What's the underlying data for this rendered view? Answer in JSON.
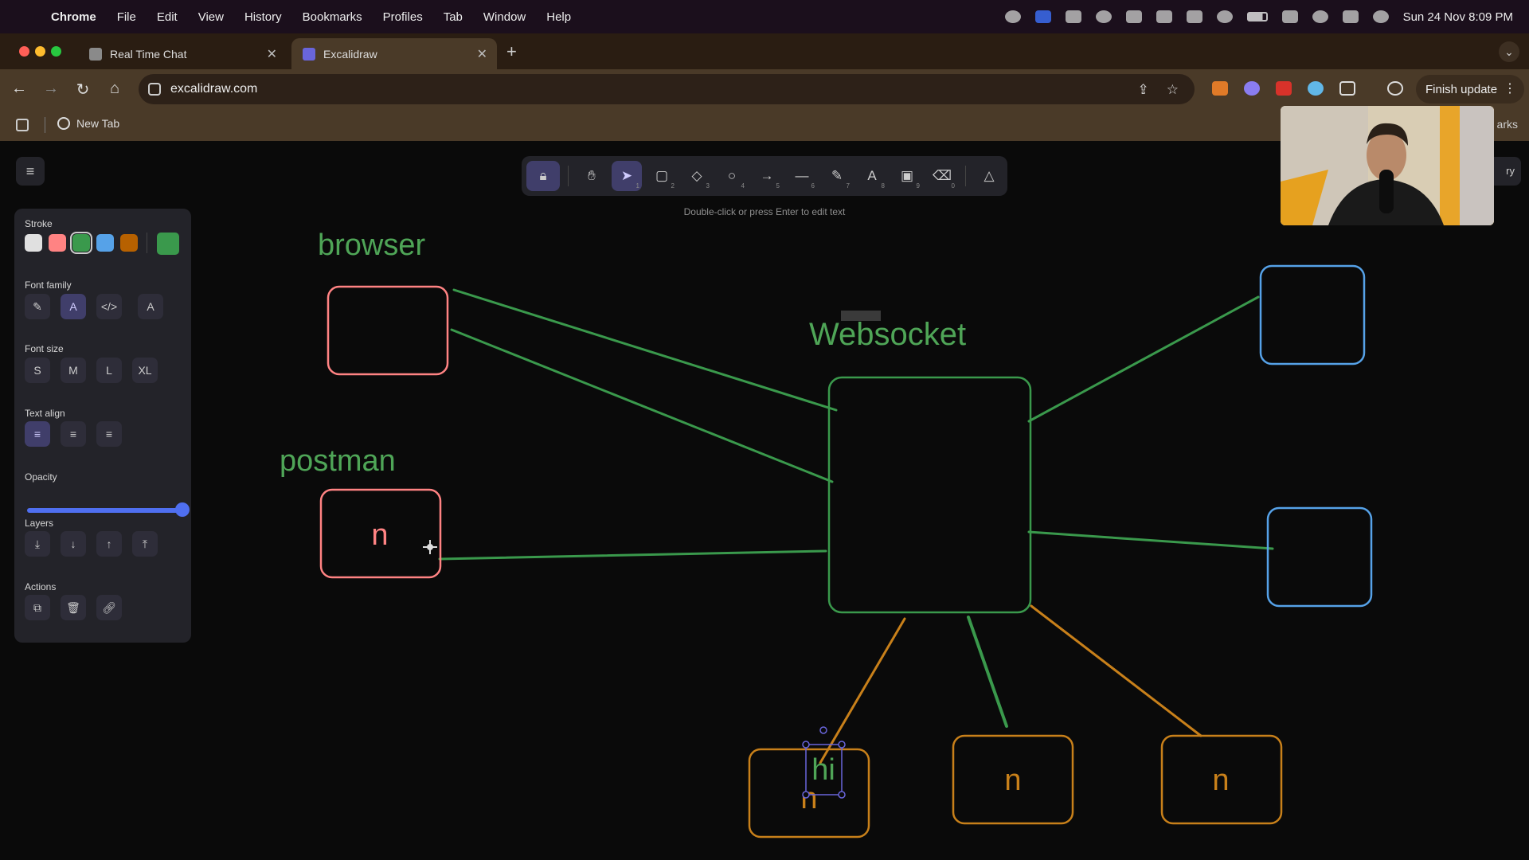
{
  "menubar": {
    "app_name": "Chrome",
    "items": [
      "File",
      "Edit",
      "View",
      "History",
      "Bookmarks",
      "Profiles",
      "Tab",
      "Window",
      "Help"
    ],
    "clock": "Sun 24 Nov  8:09 PM"
  },
  "tabs": [
    {
      "title": "Real Time Chat",
      "active": false
    },
    {
      "title": "Excalidraw",
      "active": true
    }
  ],
  "omnibox": {
    "url": "excalidraw.com"
  },
  "toolbar": {
    "finish_update": "Finish update"
  },
  "bookmarks": {
    "items": [
      "New Tab"
    ],
    "overflow": "arks"
  },
  "excalidraw": {
    "hint": "Double-click or press Enter to edit text",
    "tools": [
      {
        "name": "lock",
        "key": ""
      },
      {
        "name": "hand",
        "key": ""
      },
      {
        "name": "selection",
        "key": "1"
      },
      {
        "name": "rectangle",
        "key": "2"
      },
      {
        "name": "diamond",
        "key": "3"
      },
      {
        "name": "ellipse",
        "key": "4"
      },
      {
        "name": "arrow",
        "key": "5"
      },
      {
        "name": "line",
        "key": "6"
      },
      {
        "name": "draw",
        "key": "7"
      },
      {
        "name": "text",
        "key": "8"
      },
      {
        "name": "image",
        "key": "9"
      },
      {
        "name": "eraser",
        "key": "0"
      },
      {
        "name": "extra-tools",
        "key": ""
      }
    ],
    "library_partial": "ry",
    "properties": {
      "stroke_label": "Stroke",
      "stroke_colors": [
        "#e0e0e0",
        "#ff8383",
        "#3a994c",
        "#56a2e8",
        "#b76100"
      ],
      "current_stroke": "#3a994c",
      "font_family_label": "Font family",
      "font_size_label": "Font size",
      "font_sizes": [
        "S",
        "M",
        "L",
        "XL"
      ],
      "text_align_label": "Text align",
      "opacity_label": "Opacity",
      "opacity_value": 100,
      "layers_label": "Layers",
      "actions_label": "Actions"
    },
    "canvas_texts": {
      "browser": "browser",
      "postman": "postman",
      "websocket": "Websocket",
      "postman_box": "n",
      "bottom_left_box": "n",
      "bottom_left_editing": "hi",
      "bottom_mid_box": "n",
      "bottom_right_box": "n"
    },
    "colors": {
      "red": "#ff8383",
      "green": "#3a994c",
      "green_text": "#4fa557",
      "blue": "#56a2e8",
      "orange": "#c8801a",
      "selection": "#6965db"
    }
  }
}
